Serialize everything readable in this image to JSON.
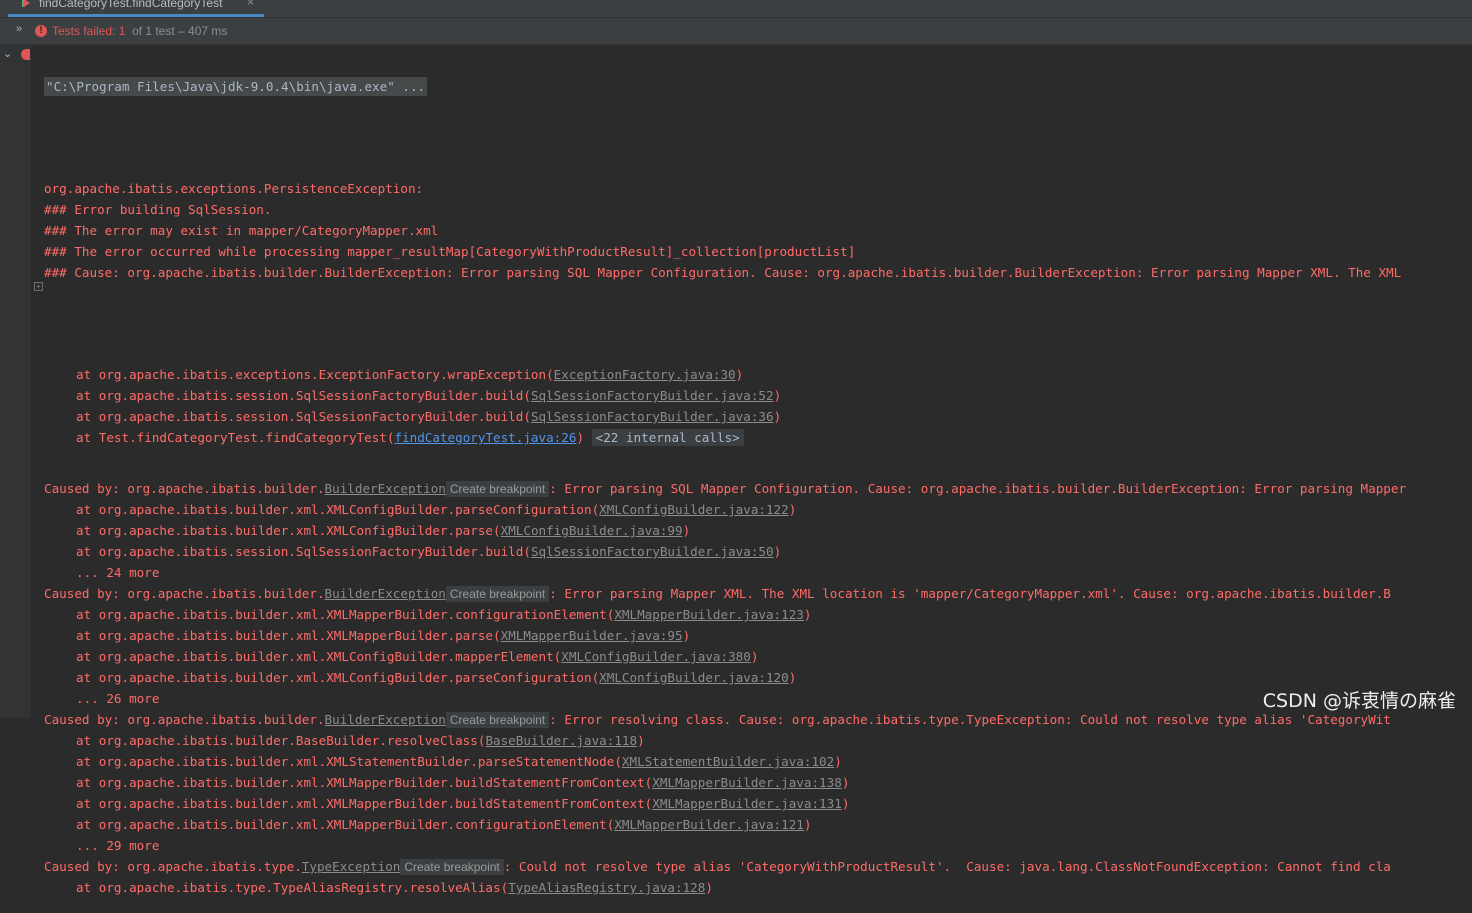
{
  "tab": {
    "title": "findCategoryTest.findCategoryTest",
    "close": "×"
  },
  "status": {
    "label": "Tests failed: 1",
    "detail": "of 1 test – 407 ms"
  },
  "icons": {
    "tab": "run-config-icon",
    "fail": "error-circle-icon",
    "expand": "double-chevron-icon",
    "collapse": "chevron-down-icon",
    "fold": "plus-icon"
  },
  "colors": {
    "error": "#ff6b68",
    "link": "#5394ec",
    "background": "#2b2b2b"
  },
  "console": {
    "command": "\"C:\\Program Files\\Java\\jdk-9.0.4\\bin\\java.exe\" ...",
    "header": [
      "org.apache.ibatis.exceptions.PersistenceException: ",
      "### Error building SqlSession.",
      "### The error may exist in mapper/CategoryMapper.xml",
      "### The error occurred while processing mapper_resultMap[CategoryWithProductResult]_collection[productList]",
      "### Cause: org.apache.ibatis.builder.BuilderException: Error parsing SQL Mapper Configuration. Cause: org.apache.ibatis.builder.BuilderException: Error parsing Mapper XML. The XML"
    ],
    "stack0": [
      {
        "pre": "at org.apache.ibatis.exceptions.ExceptionFactory.wrapException(",
        "link": "ExceptionFactory.java:30",
        "post": ")"
      },
      {
        "pre": "at org.apache.ibatis.session.SqlSessionFactoryBuilder.build(",
        "link": "SqlSessionFactoryBuilder.java:52",
        "post": ")"
      },
      {
        "pre": "at org.apache.ibatis.session.SqlSessionFactoryBuilder.build(",
        "link": "SqlSessionFactoryBuilder.java:36",
        "post": ")"
      },
      {
        "pre": "at Test.findCategoryTest.findCategoryTest(",
        "link": "findCategoryTest.java:26",
        "post": ")",
        "hint": "<22 internal calls>"
      }
    ],
    "breakpoint_label": "Create breakpoint",
    "caused": [
      {
        "pre": "Caused by: org.apache.ibatis.builder.",
        "cls": "BuilderException",
        "msg": ": Error parsing SQL Mapper Configuration. Cause: org.apache.ibatis.builder.BuilderException: Error parsing Mapper",
        "frames": [
          {
            "pre": "at org.apache.ibatis.builder.xml.XMLConfigBuilder.parseConfiguration(",
            "link": "XMLConfigBuilder.java:122",
            "post": ")"
          },
          {
            "pre": "at org.apache.ibatis.builder.xml.XMLConfigBuilder.parse(",
            "link": "XMLConfigBuilder.java:99",
            "post": ")"
          },
          {
            "pre": "at org.apache.ibatis.session.SqlSessionFactoryBuilder.build(",
            "link": "SqlSessionFactoryBuilder.java:50",
            "post": ")"
          }
        ],
        "more": "... 24 more"
      },
      {
        "pre": "Caused by: org.apache.ibatis.builder.",
        "cls": "BuilderException",
        "msg": ": Error parsing Mapper XML. The XML location is 'mapper/CategoryMapper.xml'. Cause: org.apache.ibatis.builder.B",
        "frames": [
          {
            "pre": "at org.apache.ibatis.builder.xml.XMLMapperBuilder.configurationElement(",
            "link": "XMLMapperBuilder.java:123",
            "post": ")"
          },
          {
            "pre": "at org.apache.ibatis.builder.xml.XMLMapperBuilder.parse(",
            "link": "XMLMapperBuilder.java:95",
            "post": ")"
          },
          {
            "pre": "at org.apache.ibatis.builder.xml.XMLConfigBuilder.mapperElement(",
            "link": "XMLConfigBuilder.java:380",
            "post": ")"
          },
          {
            "pre": "at org.apache.ibatis.builder.xml.XMLConfigBuilder.parseConfiguration(",
            "link": "XMLConfigBuilder.java:120",
            "post": ")"
          }
        ],
        "more": "... 26 more"
      },
      {
        "pre": "Caused by: org.apache.ibatis.builder.",
        "cls": "BuilderException",
        "msg": ": Error resolving class. Cause: org.apache.ibatis.type.TypeException: Could not resolve type alias 'CategoryWit",
        "frames": [
          {
            "pre": "at org.apache.ibatis.builder.BaseBuilder.resolveClass(",
            "link": "BaseBuilder.java:118",
            "post": ")"
          },
          {
            "pre": "at org.apache.ibatis.builder.xml.XMLStatementBuilder.parseStatementNode(",
            "link": "XMLStatementBuilder.java:102",
            "post": ")"
          },
          {
            "pre": "at org.apache.ibatis.builder.xml.XMLMapperBuilder.buildStatementFromContext(",
            "link": "XMLMapperBuilder.java:138",
            "post": ")"
          },
          {
            "pre": "at org.apache.ibatis.builder.xml.XMLMapperBuilder.buildStatementFromContext(",
            "link": "XMLMapperBuilder.java:131",
            "post": ")"
          },
          {
            "pre": "at org.apache.ibatis.builder.xml.XMLMapperBuilder.configurationElement(",
            "link": "XMLMapperBuilder.java:121",
            "post": ")"
          }
        ],
        "more": "... 29 more"
      },
      {
        "pre": "Caused by: org.apache.ibatis.type.",
        "cls": "TypeException",
        "msg": ": Could not resolve type alias 'CategoryWithProductResult'.  Cause: java.lang.ClassNotFoundException: Cannot find cla",
        "frames": [
          {
            "pre": "at org.apache.ibatis.type.TypeAliasRegistry.resolveAlias(",
            "link": "TypeAliasRegistry.java:128",
            "post": ")"
          }
        ],
        "more": ""
      }
    ]
  },
  "watermark": "CSDN @诉衷情の麻雀"
}
